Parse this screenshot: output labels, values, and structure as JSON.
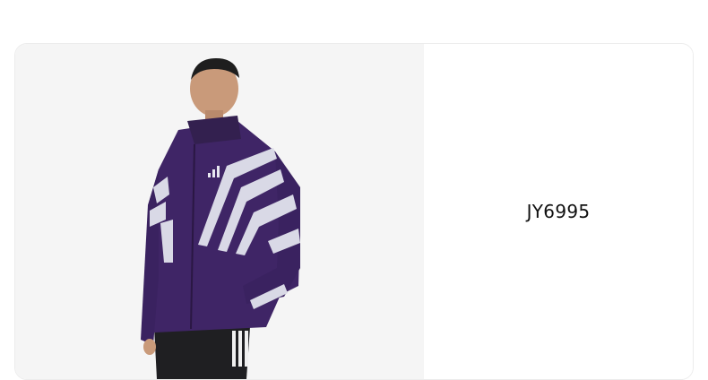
{
  "product": {
    "sku": "JY6995",
    "image": {
      "subject": "model-wearing-purple-track-jacket",
      "jacket_color": "#3f2566",
      "stripe_color": "#d9d9e6",
      "background_color": "#f5f5f5"
    }
  }
}
